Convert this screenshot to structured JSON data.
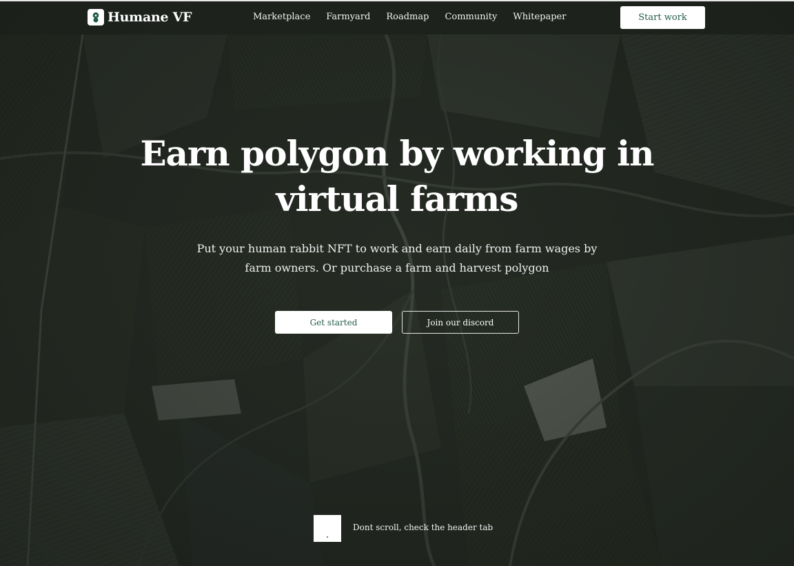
{
  "brand": {
    "name": "Humane VF",
    "logo_icon": "rabbit-leaf-icon"
  },
  "nav": {
    "items": [
      {
        "label": "Marketplace"
      },
      {
        "label": "Farmyard"
      },
      {
        "label": "Roadmap"
      },
      {
        "label": "Community"
      },
      {
        "label": "Whitepaper"
      }
    ],
    "cta_label": "Start work"
  },
  "hero": {
    "title_line1": "Earn polygon by working in",
    "title_line2": "virtual farms",
    "subtitle_line1": "Put your human rabbit NFT to work and earn daily from farm wages by",
    "subtitle_line2": "farm owners. Or purchase a farm and harvest polygon",
    "primary_button": "Get started",
    "secondary_button": "Join our discord"
  },
  "footer_hint": {
    "text": "Dont scroll, check the header tab"
  },
  "colors": {
    "accent_green": "#1f5c45",
    "field_dark": "#262c25",
    "button_bg": "#ffffff"
  }
}
